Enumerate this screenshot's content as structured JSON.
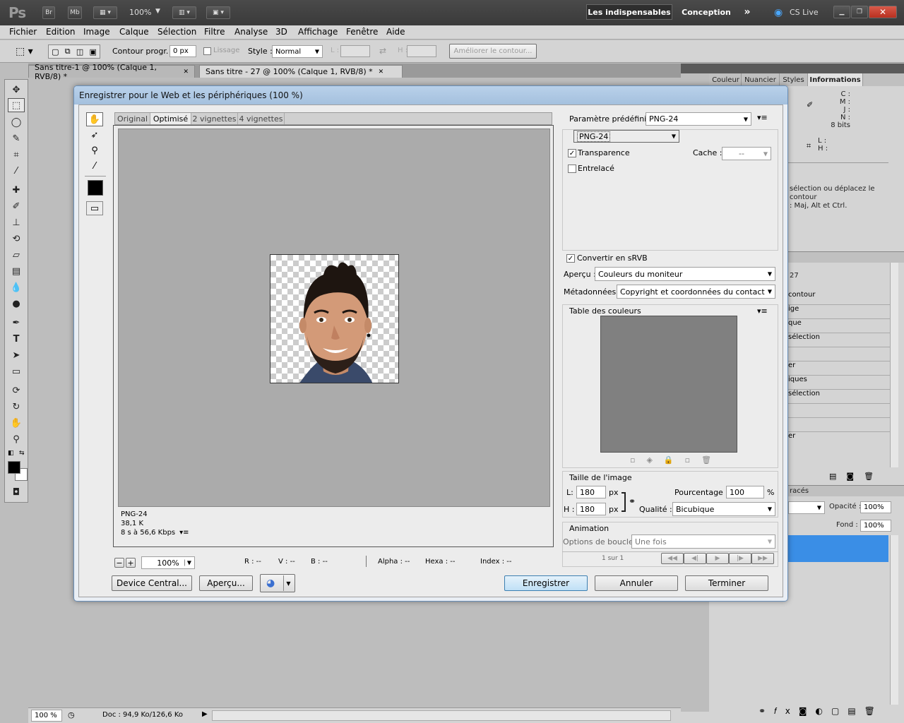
{
  "app": {
    "logo": "Ps",
    "bridge": "Br",
    "minibridge": "Mb",
    "zoom": "100%",
    "workspaces": [
      "Les indispensables",
      "Conception"
    ],
    "cslive": "CS Live"
  },
  "menu": [
    "Fichier",
    "Edition",
    "Image",
    "Calque",
    "Sélection",
    "Filtre",
    "Analyse",
    "3D",
    "Affichage",
    "Fenêtre",
    "Aide"
  ],
  "options": {
    "feather_label": "Contour progr. :",
    "feather_value": "0 px",
    "antialias_label": "Lissage",
    "style_label": "Style :",
    "style_value": "Normal",
    "w_label": "L :",
    "h_label": "H :",
    "refine_edge": "Améliorer le contour..."
  },
  "doc_tabs": [
    "Sans titre-1 @ 100% (Calque 1, RVB/8) *",
    "Sans titre - 27 @ 100% (Calque 1, RVB/8) *"
  ],
  "right_panel": {
    "tabs": [
      "Couleur",
      "Nuancier",
      "Styles",
      "Informations"
    ],
    "info_letters": [
      "C :",
      "M :",
      "J :",
      "N :"
    ],
    "bits": "8 bits",
    "lh": [
      "L :",
      "H :"
    ],
    "hint": "sélection ou déplacez le contour",
    "hint2": ": Maj, Alt et Ctrl.",
    "history_number": "27",
    "history_items": [
      "contour",
      "ige",
      "que",
      "sélection",
      "",
      "er",
      "iques",
      "sélection",
      "",
      "",
      "er"
    ],
    "layers_tab": "racés",
    "opacity_label": "Opacité :",
    "opacity_value": "100%",
    "fill_label": "Fond :",
    "fill_value": "100%"
  },
  "status": {
    "zoom": "100 %",
    "doc": "Doc : 94,9 Ko/126,6 Ko"
  },
  "dialog": {
    "title": "Enregistrer pour le Web et les périphériques (100 %)",
    "preview_tabs": [
      "Original",
      "Optimisé",
      "2 vignettes",
      "4 vignettes"
    ],
    "preview_info": [
      "PNG-24",
      "38,1 K",
      "8 s à 56,6 Kbps"
    ],
    "zoom": "100%",
    "readouts": [
      "R : --",
      "V : --",
      "B : --",
      "Alpha : --",
      "Hexa : --",
      "Index : --"
    ],
    "preset_label": "Paramètre prédéfini :",
    "preset_value": "PNG-24",
    "format_value": "PNG-24",
    "transparency": "Transparence",
    "cache_label": "Cache :",
    "cache_value": "--",
    "interlaced": "Entrelacé",
    "convert_srgb": "Convertir en sRVB",
    "preview_label": "Aperçu :",
    "preview_value": "Couleurs du moniteur",
    "metadata_label": "Métadonnées :",
    "metadata_value": "Copyright et coordonnées du contact",
    "color_table": "Table des couleurs",
    "image_size": "Taille de l'image",
    "w_label": "L:",
    "w_value": "180",
    "h_label": "H :",
    "h_value": "180",
    "px": "px",
    "percent_label": "Pourcentage :",
    "percent_value": "100",
    "percent_sign": "%",
    "quality_label": "Qualité :",
    "quality_value": "Bicubique",
    "animation": "Animation",
    "loop_label": "Options de boucle :",
    "loop_value": "Une fois",
    "frame": "1 sur 1",
    "device_central": "Device Central...",
    "preview_btn": "Aperçu...",
    "save": "Enregistrer",
    "cancel": "Annuler",
    "done": "Terminer"
  }
}
